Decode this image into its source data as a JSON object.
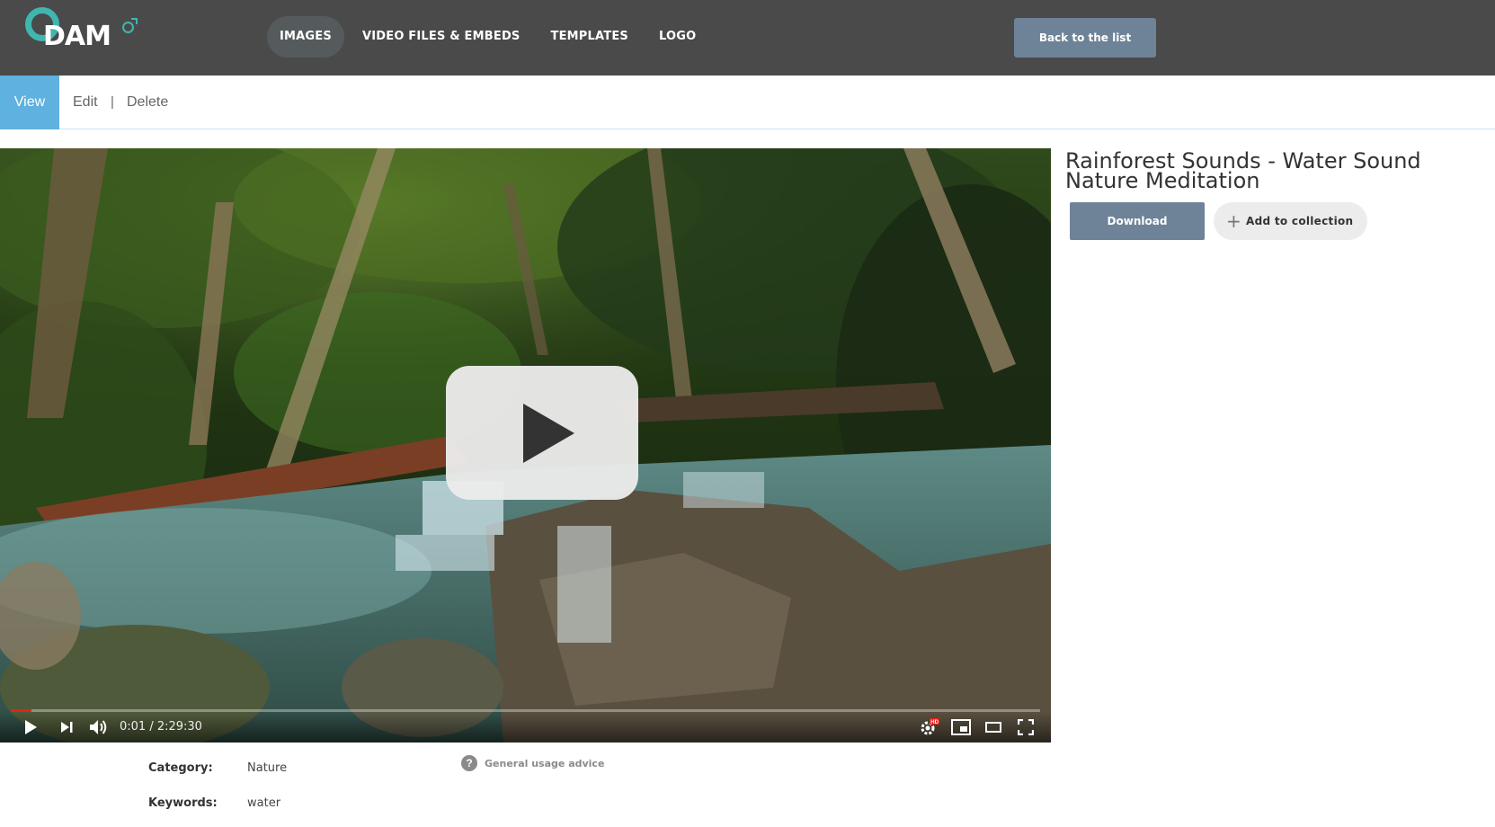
{
  "brand": {
    "logo_text": "DAM"
  },
  "nav": {
    "items": [
      {
        "label": "IMAGES",
        "active": true
      },
      {
        "label": "VIDEO FILES & EMBEDS",
        "active": false
      },
      {
        "label": "TEMPLATES",
        "active": false
      },
      {
        "label": "LOGO",
        "active": false
      }
    ],
    "back_label": "Back to the list"
  },
  "tabs": {
    "view": "View",
    "edit": "Edit",
    "separator": "|",
    "delete": "Delete"
  },
  "player": {
    "time": "0:01 / 2:29:30",
    "progress": 0.0001,
    "icons": [
      "play-icon",
      "next-icon",
      "volume-icon",
      "settings-hd-icon",
      "miniplayer-icon",
      "theater-icon",
      "fullscreen-icon"
    ]
  },
  "asset": {
    "title": "Rainforest Sounds - Water Sound Nature Meditation",
    "download_label": "Download",
    "add_collection_label": "Add to collection"
  },
  "meta": {
    "category_label": "Category:",
    "category_value": "Nature",
    "keywords_label": "Keywords:",
    "keywords_value": "water",
    "advice_label": "General usage advice"
  },
  "colors": {
    "header_bg": "#4a4a4a",
    "accent_teal": "#3fb6b0",
    "button_blue": "#6e8398",
    "tab_active": "#5fb1e0"
  }
}
